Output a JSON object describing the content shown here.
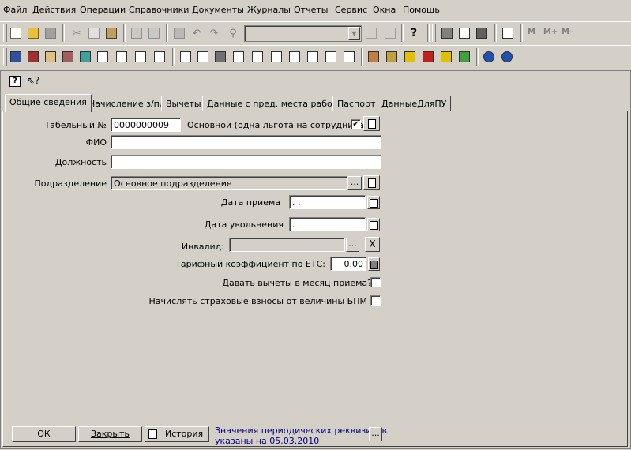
{
  "menu": [
    "Файл",
    "Действия",
    "Операции",
    "Справочники",
    "Документы",
    "Журналы",
    "Отчеты",
    "Сервис",
    "Окна",
    "Помощь"
  ],
  "toolbar": {
    "m_labels": [
      "M",
      "M+",
      "M–"
    ]
  },
  "tabs": [
    "Общие сведения",
    "Начисление з/пл",
    "Вычеты",
    "Данные с пред. места работы",
    "Паспорт",
    "ДанныеДляПУ"
  ],
  "form": {
    "tabnum_label": "Табельный №",
    "tabnum_value": "0000000009",
    "main_benefit_label": "Основной (одна льгота  на сотрудника)",
    "main_benefit_checked": "✔",
    "fio_label": "ФИО",
    "fio_value": "",
    "position_label": "Должность",
    "position_value": "",
    "division_label": "Подразделение",
    "division_value": "Основное подразделение",
    "hire_date_label": "Дата приема",
    "hire_date_value": " .  .",
    "dismiss_date_label": "Дата увольнения",
    "dismiss_date_value": " .  .",
    "invalid_label": "Инвалид:",
    "invalid_value": "",
    "tariff_label": "Тарифный коэффициент по ЕТС:",
    "tariff_value": "0.00",
    "deductions_label": "Давать вычеты в месяц приема?",
    "insurance_label": "Начислять страховые взносы от величины БПМ",
    "ellipsis": "...",
    "clear": "X"
  },
  "footer": {
    "ok": "ОК",
    "close": "Закрыть",
    "history": "История",
    "note_line1": "Значения периодических реквизитов",
    "note_line2": "указаны на 05.03.2010",
    "more": "..."
  }
}
